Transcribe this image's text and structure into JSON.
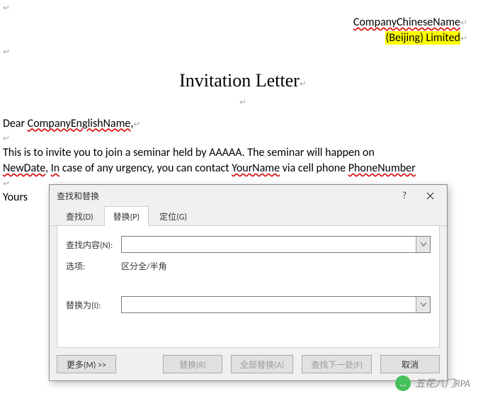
{
  "document": {
    "company_cn": "CompanyChineseName",
    "company_suffix": "(Beijing) Limited",
    "title": "Invitation Letter",
    "dear": "Dear ",
    "company_en": "CompanyEnglishName",
    "comma": ",",
    "para1_a": "This is to invite you to join a seminar held by AAAAA. The seminar will happen on ",
    "newdate": "NewDate",
    "para1_b": ", ",
    "in": "In",
    "para1_c": " case of any urgency, you can contact ",
    "yourname": "YourName",
    "para1_d": " via cell phone ",
    "phonenumber": "PhoneNumber",
    "yours": "Yours "
  },
  "dialog": {
    "title": "查找和替换",
    "help": "?",
    "tabs": {
      "find": "查找(D)",
      "replace": "替换(P)",
      "goto": "定位(G)"
    },
    "labels": {
      "find_what": "查找内容(N):",
      "options": "选项:",
      "options_value": "区分全/半角",
      "replace_with": "替换为(I):"
    },
    "values": {
      "find_what": "",
      "replace_with": ""
    },
    "buttons": {
      "more": "更多(M) >>",
      "replace": "替换(R)",
      "replace_all": "全部替换(A)",
      "find_next": "查找下一处(F)",
      "cancel": "取消"
    }
  },
  "watermark": {
    "icon": "…",
    "text": "五花八门RPA"
  }
}
